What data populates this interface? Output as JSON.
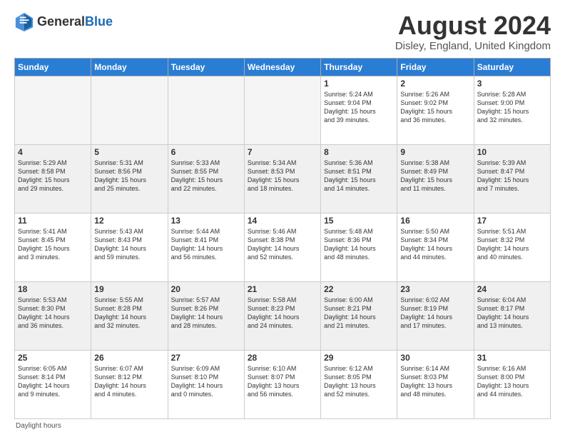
{
  "header": {
    "logo_general": "General",
    "logo_blue": "Blue",
    "month_year": "August 2024",
    "location": "Disley, England, United Kingdom"
  },
  "days_of_week": [
    "Sunday",
    "Monday",
    "Tuesday",
    "Wednesday",
    "Thursday",
    "Friday",
    "Saturday"
  ],
  "footer_text": "Daylight hours",
  "weeks": [
    [
      {
        "day": "",
        "info": ""
      },
      {
        "day": "",
        "info": ""
      },
      {
        "day": "",
        "info": ""
      },
      {
        "day": "",
        "info": ""
      },
      {
        "day": "1",
        "info": "Sunrise: 5:24 AM\nSunset: 9:04 PM\nDaylight: 15 hours\nand 39 minutes."
      },
      {
        "day": "2",
        "info": "Sunrise: 5:26 AM\nSunset: 9:02 PM\nDaylight: 15 hours\nand 36 minutes."
      },
      {
        "day": "3",
        "info": "Sunrise: 5:28 AM\nSunset: 9:00 PM\nDaylight: 15 hours\nand 32 minutes."
      }
    ],
    [
      {
        "day": "4",
        "info": "Sunrise: 5:29 AM\nSunset: 8:58 PM\nDaylight: 15 hours\nand 29 minutes."
      },
      {
        "day": "5",
        "info": "Sunrise: 5:31 AM\nSunset: 8:56 PM\nDaylight: 15 hours\nand 25 minutes."
      },
      {
        "day": "6",
        "info": "Sunrise: 5:33 AM\nSunset: 8:55 PM\nDaylight: 15 hours\nand 22 minutes."
      },
      {
        "day": "7",
        "info": "Sunrise: 5:34 AM\nSunset: 8:53 PM\nDaylight: 15 hours\nand 18 minutes."
      },
      {
        "day": "8",
        "info": "Sunrise: 5:36 AM\nSunset: 8:51 PM\nDaylight: 15 hours\nand 14 minutes."
      },
      {
        "day": "9",
        "info": "Sunrise: 5:38 AM\nSunset: 8:49 PM\nDaylight: 15 hours\nand 11 minutes."
      },
      {
        "day": "10",
        "info": "Sunrise: 5:39 AM\nSunset: 8:47 PM\nDaylight: 15 hours\nand 7 minutes."
      }
    ],
    [
      {
        "day": "11",
        "info": "Sunrise: 5:41 AM\nSunset: 8:45 PM\nDaylight: 15 hours\nand 3 minutes."
      },
      {
        "day": "12",
        "info": "Sunrise: 5:43 AM\nSunset: 8:43 PM\nDaylight: 14 hours\nand 59 minutes."
      },
      {
        "day": "13",
        "info": "Sunrise: 5:44 AM\nSunset: 8:41 PM\nDaylight: 14 hours\nand 56 minutes."
      },
      {
        "day": "14",
        "info": "Sunrise: 5:46 AM\nSunset: 8:38 PM\nDaylight: 14 hours\nand 52 minutes."
      },
      {
        "day": "15",
        "info": "Sunrise: 5:48 AM\nSunset: 8:36 PM\nDaylight: 14 hours\nand 48 minutes."
      },
      {
        "day": "16",
        "info": "Sunrise: 5:50 AM\nSunset: 8:34 PM\nDaylight: 14 hours\nand 44 minutes."
      },
      {
        "day": "17",
        "info": "Sunrise: 5:51 AM\nSunset: 8:32 PM\nDaylight: 14 hours\nand 40 minutes."
      }
    ],
    [
      {
        "day": "18",
        "info": "Sunrise: 5:53 AM\nSunset: 8:30 PM\nDaylight: 14 hours\nand 36 minutes."
      },
      {
        "day": "19",
        "info": "Sunrise: 5:55 AM\nSunset: 8:28 PM\nDaylight: 14 hours\nand 32 minutes."
      },
      {
        "day": "20",
        "info": "Sunrise: 5:57 AM\nSunset: 8:26 PM\nDaylight: 14 hours\nand 28 minutes."
      },
      {
        "day": "21",
        "info": "Sunrise: 5:58 AM\nSunset: 8:23 PM\nDaylight: 14 hours\nand 24 minutes."
      },
      {
        "day": "22",
        "info": "Sunrise: 6:00 AM\nSunset: 8:21 PM\nDaylight: 14 hours\nand 21 minutes."
      },
      {
        "day": "23",
        "info": "Sunrise: 6:02 AM\nSunset: 8:19 PM\nDaylight: 14 hours\nand 17 minutes."
      },
      {
        "day": "24",
        "info": "Sunrise: 6:04 AM\nSunset: 8:17 PM\nDaylight: 14 hours\nand 13 minutes."
      }
    ],
    [
      {
        "day": "25",
        "info": "Sunrise: 6:05 AM\nSunset: 8:14 PM\nDaylight: 14 hours\nand 9 minutes."
      },
      {
        "day": "26",
        "info": "Sunrise: 6:07 AM\nSunset: 8:12 PM\nDaylight: 14 hours\nand 4 minutes."
      },
      {
        "day": "27",
        "info": "Sunrise: 6:09 AM\nSunset: 8:10 PM\nDaylight: 14 hours\nand 0 minutes."
      },
      {
        "day": "28",
        "info": "Sunrise: 6:10 AM\nSunset: 8:07 PM\nDaylight: 13 hours\nand 56 minutes."
      },
      {
        "day": "29",
        "info": "Sunrise: 6:12 AM\nSunset: 8:05 PM\nDaylight: 13 hours\nand 52 minutes."
      },
      {
        "day": "30",
        "info": "Sunrise: 6:14 AM\nSunset: 8:03 PM\nDaylight: 13 hours\nand 48 minutes."
      },
      {
        "day": "31",
        "info": "Sunrise: 6:16 AM\nSunset: 8:00 PM\nDaylight: 13 hours\nand 44 minutes."
      }
    ]
  ]
}
